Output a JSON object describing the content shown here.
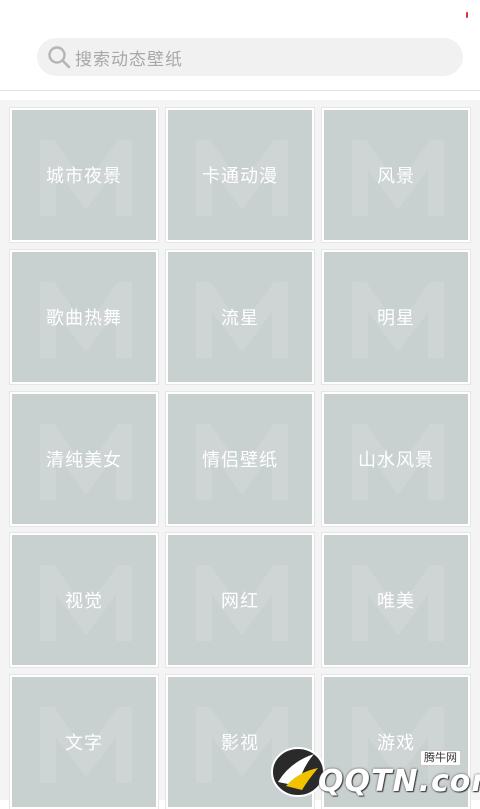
{
  "search": {
    "placeholder": "搜索动态壁纸"
  },
  "categories": [
    {
      "label": "城市夜景"
    },
    {
      "label": "卡通动漫"
    },
    {
      "label": "风景"
    },
    {
      "label": "歌曲热舞"
    },
    {
      "label": "流星"
    },
    {
      "label": "明星"
    },
    {
      "label": "清纯美女"
    },
    {
      "label": "情侣壁纸"
    },
    {
      "label": "山水风景"
    },
    {
      "label": "视觉"
    },
    {
      "label": "网红"
    },
    {
      "label": "唯美"
    },
    {
      "label": "文字"
    },
    {
      "label": "影视"
    },
    {
      "label": "游戏"
    }
  ],
  "watermark": {
    "site_chinese": "腾牛网",
    "site_text": "QQTN.com"
  },
  "colors": {
    "tile_background": "#c9d0d0",
    "tile_label": "#ffffff",
    "search_background": "#f1f1f1",
    "placeholder": "#a8a8a8",
    "status_indicator": "#e0303a"
  }
}
